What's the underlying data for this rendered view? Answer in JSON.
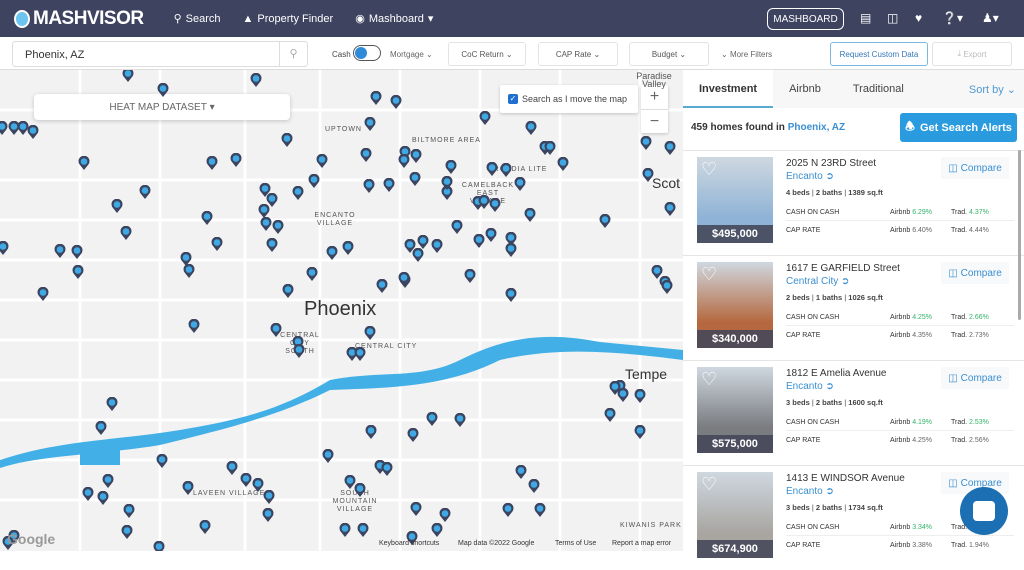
{
  "nav": {
    "brand": "MASHVISOR",
    "search": "Search",
    "property_finder": "Property Finder",
    "mashboard": "Mashboard",
    "mashboard_button": "MASHBOARD"
  },
  "filters": {
    "location": "Phoenix, AZ",
    "cash": "Cash",
    "mortgage": "Mortgage",
    "coc": "CoC Return",
    "cap": "CAP Rate",
    "budget": "Budget",
    "more": "More Filters",
    "request": "Request Custom Data",
    "export": "Export"
  },
  "map": {
    "heat": "HEAT MAP DATASET",
    "search_move": "Search as I move the map",
    "city": "Phoenix",
    "tempe": "Tempe",
    "scottsdale": "Scot",
    "paradise": "Paradise Valley",
    "labels": [
      "UPTOWN",
      "BILTMORE AREA",
      "ARCADIA LITE",
      "CAMELBACK EAST VILLAGE",
      "ENCANTO VILLAGE",
      "CENTRAL CITY SOUTH",
      "CENTRAL CITY",
      "LAVEEN VILLAGE",
      "SOUTH MOUNTAIN VILLAGE",
      "KIWANIS PARK"
    ],
    "google": "Google",
    "attribution": [
      "Keyboard shortcuts",
      "Map data ©2022 Google",
      "Terms of Use",
      "Report a map error"
    ]
  },
  "panel": {
    "tabs": [
      "Investment",
      "Airbnb",
      "Traditional"
    ],
    "sort": "Sort by",
    "count_prefix": "459 homes found in",
    "count_city": "Phoenix, AZ",
    "alerts": "Get Search Alerts",
    "compare": "Compare",
    "coc_label": "CASH ON CASH",
    "cap_label": "CAP RATE",
    "airbnb": "Airbnb",
    "trad": "Trad.",
    "listings": [
      {
        "address": "2025 N 23RD Street",
        "hood": "Encanto",
        "beds": "4 beds",
        "baths": "2 baths",
        "sqft": "1389 sq.ft",
        "price": "$495,000",
        "coc_airbnb": "6.29%",
        "coc_trad": "4.37%",
        "cap_airbnb": "6.40%",
        "cap_trad": "4.44%",
        "photo": "#8fb3d6"
      },
      {
        "address": "1617 E GARFIELD Street",
        "hood": "Central City",
        "beds": "2 beds",
        "baths": "1 baths",
        "sqft": "1026 sq.ft",
        "price": "$340,000",
        "coc_airbnb": "4.25%",
        "coc_trad": "2.66%",
        "cap_airbnb": "4.35%",
        "cap_trad": "2.73%",
        "photo": "#b5683f"
      },
      {
        "address": "1812 E Amelia Avenue",
        "hood": "Encanto",
        "beds": "3 beds",
        "baths": "2 baths",
        "sqft": "1600 sq.ft",
        "price": "$575,000",
        "coc_airbnb": "4.19%",
        "coc_trad": "2.53%",
        "cap_airbnb": "4.25%",
        "cap_trad": "2.56%",
        "photo": "#7a7c80"
      },
      {
        "address": "1413 E WINDSOR Avenue",
        "hood": "Encanto",
        "beds": "3 beds",
        "baths": "2 baths",
        "sqft": "1734 sq.ft",
        "price": "$674,900",
        "coc_airbnb": "3.34%",
        "coc_trad": "",
        "cap_airbnb": "3.38%",
        "cap_trad": "1.94%",
        "photo": "#a9a6a2"
      }
    ]
  }
}
